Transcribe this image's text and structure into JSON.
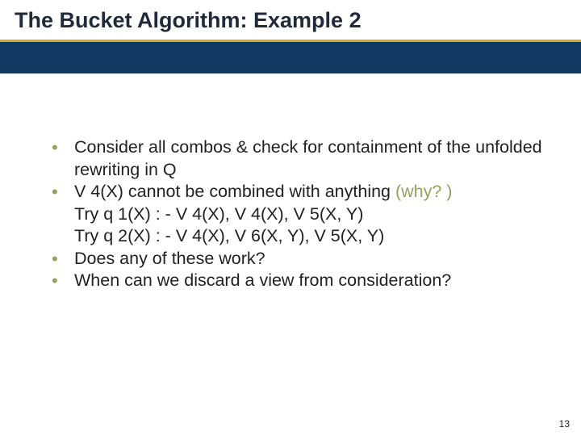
{
  "title": "The Bucket Algorithm: Example 2",
  "bullets": [
    {
      "lines": [
        "Consider all combos & check for containment of the unfolded rewriting in Q"
      ]
    },
    {
      "lines": [
        "V 4(X) cannot be combined with anything ",
        "Try q 1(X) : - V 4(X), V 4(X), V 5(X, Y)",
        "Try q 2(X) : - V 4(X), V 6(X, Y), V 5(X, Y)"
      ],
      "why": "(why? )"
    },
    {
      "lines": [
        "Does any of these work?"
      ]
    },
    {
      "lines": [
        "When can we discard a view from consideration?"
      ]
    }
  ],
  "page_number": "13"
}
